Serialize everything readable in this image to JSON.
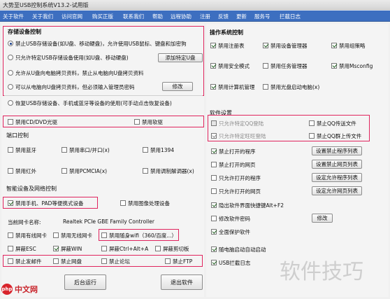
{
  "window": {
    "title": "大势至USB控制系统V13.2-试用版"
  },
  "menu": [
    "关于软件",
    "关于我们",
    "访问官网",
    "购买正版",
    "联系我们",
    "帮助",
    "远程协助",
    "注册",
    "反馈",
    "更新",
    "服务号",
    "拦截日志"
  ],
  "storage": {
    "title": "存储设备控制",
    "options": [
      {
        "label": "禁止USB存储设备(如U盘、移动硬盘)，允许使用USB鼠标、键盘和加密狗",
        "checked": true
      },
      {
        "label": "只允许特定USB存储设备使用(如U盘、移动硬盘)",
        "checked": false
      },
      {
        "label": "允许从U盘向电脑拷贝资料，禁止从电脑向U盘拷贝资料",
        "checked": false
      },
      {
        "label": "可以从电脑向U盘拷贝资料，但必须输入管理员密码",
        "checked": false
      },
      {
        "label": "恢复USB存储设备、手机或蓝牙等设备的使用(可手动点击恢复设备)",
        "checked": false
      }
    ],
    "add_device_button": "添加特定U盘",
    "modify_button": "修改"
  },
  "cd": {
    "disable_cd": "禁用CD/DVD光驱",
    "disable_floppy": "禁用软驱"
  },
  "port": {
    "title": "端口控制",
    "items": [
      {
        "label": "禁用蓝牙",
        "checked": false
      },
      {
        "label": "禁用串口/并口(x)",
        "checked": false
      },
      {
        "label": "禁用1394",
        "checked": false
      },
      {
        "label": "禁用红外",
        "checked": false
      },
      {
        "label": "禁用PCMCIA(x)",
        "checked": false
      },
      {
        "label": "禁用调制解调器(x)",
        "checked": false
      }
    ]
  },
  "smart": {
    "title": "智能设备及网络控制",
    "items": [
      {
        "label": "禁用手机、PAD等便携式设备",
        "checked": true
      },
      {
        "label": "禁用图像处理设备",
        "checked": false
      }
    ]
  },
  "network": {
    "nic_label": "当前网卡名称:",
    "nic_value": "Realtek PCIe GBE Family Controller",
    "items": [
      {
        "label": "禁用有线网卡",
        "checked": false
      },
      {
        "label": "禁用无线网卡",
        "checked": false
      },
      {
        "label": "禁用随身wifi（360/百度...）",
        "checked": false
      },
      {
        "label": "屏蔽ESC",
        "checked": false
      },
      {
        "label": "屏蔽WIN",
        "checked": true
      },
      {
        "label": "屏蔽Ctrl+Alt+A",
        "checked": false
      },
      {
        "label": "屏蔽剪切板",
        "checked": false
      },
      {
        "label": "禁止发邮件",
        "checked": false
      },
      {
        "label": "禁止网盘",
        "checked": false
      },
      {
        "label": "禁止论坛",
        "checked": false
      },
      {
        "label": "禁止FTP",
        "checked": false
      }
    ]
  },
  "bottom": {
    "background_button": "后台运行",
    "exit_button": "退出软件"
  },
  "os": {
    "title": "操作系统控制",
    "items": [
      {
        "label": "禁用注册表",
        "checked": true
      },
      {
        "label": "禁用设备管理器",
        "checked": true
      },
      {
        "label": "禁用组策略",
        "checked": true
      },
      {
        "label": "禁用安全模式",
        "checked": true
      },
      {
        "label": "禁用任务管理器",
        "checked": false
      },
      {
        "label": "禁用Msconfig",
        "checked": true
      },
      {
        "label": "禁用计算机管理",
        "checked": true
      },
      {
        "label": "禁用光盘启动电脑(x)",
        "checked": false
      }
    ]
  },
  "software": {
    "title": "软件设置",
    "qq": [
      {
        "label": "只允许特定QQ登陆",
        "checked": false
      },
      {
        "label": "禁止QQ传送文件",
        "checked": false
      },
      {
        "label": "只允许特定旺旺登陆",
        "checked": true
      },
      {
        "label": "禁止QQ群上传文件",
        "checked": false
      }
    ],
    "rows": [
      {
        "label": "禁止打开的程序",
        "checked": true,
        "button": "设置禁止程序列表"
      },
      {
        "label": "禁止打开的网页",
        "checked": false,
        "button": "设置禁止网页列表"
      },
      {
        "label": "只允许打开的程序",
        "checked": false,
        "button": "设定允许程序列表"
      },
      {
        "label": "只允许打开的网页",
        "checked": false,
        "button": "设定允许网页列表"
      },
      {
        "label": "隐出软件界面快捷键Alt+F2",
        "checked": true,
        "button": ""
      },
      {
        "label": "修改软件密码",
        "checked": false,
        "button": "修改"
      },
      {
        "label": "全面保护软件",
        "checked": true,
        "button": ""
      },
      {
        "label": "随电脑启动自动启动",
        "checked": true,
        "button": ""
      },
      {
        "label": "USB拦截日志",
        "checked": true,
        "button": ""
      }
    ]
  },
  "watermark": "软件技巧",
  "logo": {
    "mark": "php",
    "text": "中文网"
  }
}
